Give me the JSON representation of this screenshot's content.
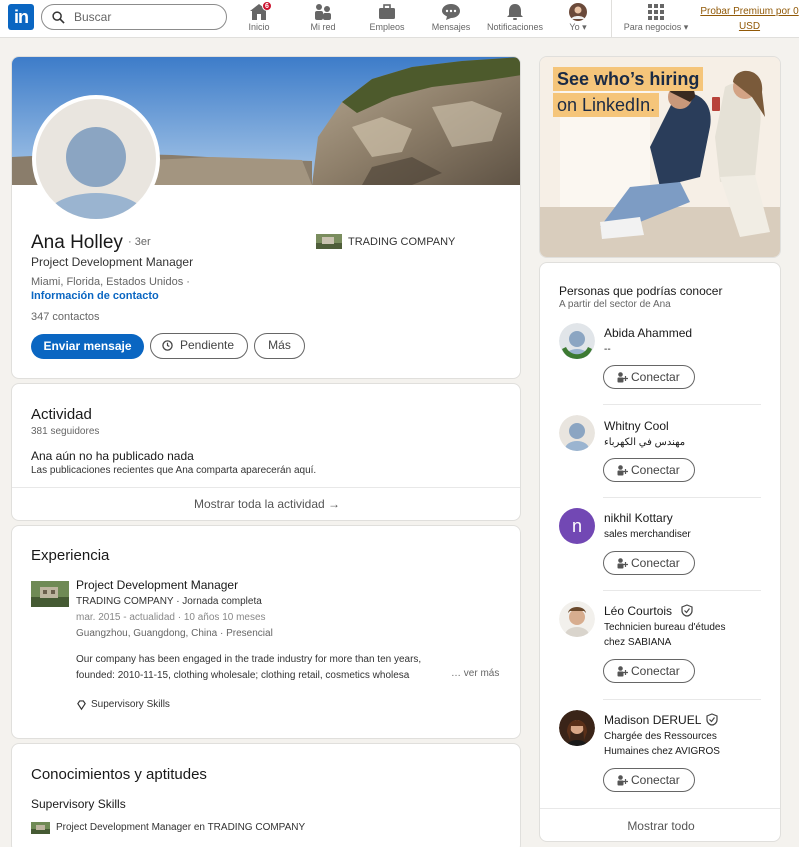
{
  "nav": {
    "logo": "in",
    "search_placeholder": "Buscar",
    "items": [
      {
        "label": "Inicio",
        "badge": "6",
        "icon": "home-icon"
      },
      {
        "label": "Mi red",
        "icon": "network-icon"
      },
      {
        "label": "Empleos",
        "icon": "briefcase-icon"
      },
      {
        "label": "Mensajes",
        "icon": "messages-icon"
      },
      {
        "label": "Notificaciones",
        "icon": "bell-icon"
      },
      {
        "label": "Yo",
        "icon": "avatar-icon"
      },
      {
        "label": "Para negocios",
        "icon": "grid-icon"
      }
    ],
    "premium_line1": "Probar Premium por 0",
    "premium_line2": "USD"
  },
  "profile": {
    "name": "Ana Holley",
    "degree": "· 3er",
    "headline": "Project Development Manager",
    "location": "Miami, Florida, Estados Unidos ·",
    "contact_info": "Información de contacto",
    "connections": "347 contactos",
    "company": "TRADING COMPANY",
    "buttons": {
      "message": "Enviar mensaje",
      "pending": "Pendiente",
      "more": "Más"
    }
  },
  "activity": {
    "title": "Actividad",
    "followers": "381 seguidores",
    "empty_title": "Ana aún no ha publicado nada",
    "empty_desc": "Las publicaciones recientes que Ana comparta aparecerán aquí.",
    "show_all": "Mostrar toda la actividad →"
  },
  "experience": {
    "title": "Experiencia",
    "role": "Project Development Manager",
    "company_line": "TRADING COMPANY · Jornada completa",
    "dates": "mar. 2015 - actualidad · 10 años 10 meses",
    "place": "Guangzhou, Guangdong, China · Presencial",
    "description": "Our company has been engaged in the trade industry for more than ten years, founded: 2010-11-15, clothing wholesale; clothing retail, cosmetics wholesa",
    "see_more": "… ver más",
    "skill": "Supervisory Skills"
  },
  "skills": {
    "title": "Conocimientos y aptitudes",
    "skill_name": "Supervisory Skills",
    "skill_context": "Project Development Manager en TRADING COMPANY"
  },
  "ad": {
    "line1": "See who’s hiring",
    "line2": "on LinkedIn."
  },
  "pymk": {
    "title": "Personas que podrías conocer",
    "subtitle": "A partir del sector de Ana",
    "connect_label": "Conectar",
    "show_all": "Mostrar todo",
    "people": [
      {
        "name": "Abida Ahammed",
        "headline1": "--",
        "headline2": ""
      },
      {
        "name": "Whitny Cool",
        "headline1": "مهندس في الكهرباء",
        "headline2": ""
      },
      {
        "name": "nikhil Kottary",
        "headline1": "sales merchandiser",
        "headline2": "",
        "initial": "n"
      },
      {
        "name": "Léo Courtois",
        "headline1": "Technicien bureau d'études",
        "headline2": "chez SABIANA"
      },
      {
        "name": "Madison DERUEL",
        "headline1": "Chargée des Ressources",
        "headline2": "Humaines chez AVIGROS"
      }
    ]
  }
}
